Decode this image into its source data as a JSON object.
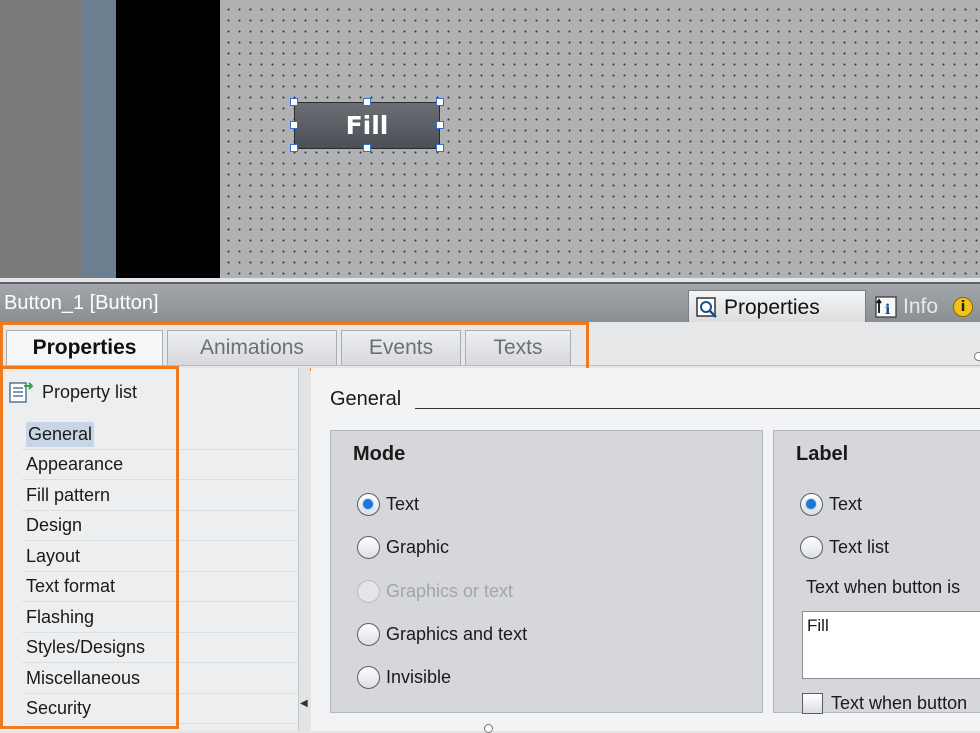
{
  "canvas": {
    "button_label": "Fill"
  },
  "inspector": {
    "selection_title": "Button_1 [Button]",
    "tabs": [
      {
        "label": "Properties",
        "icon": "properties-magnifier-icon",
        "active": true
      },
      {
        "label": "Info",
        "icon": "info-arrow-icon",
        "active": false
      }
    ],
    "diagnostics_icon": "i"
  },
  "subtabs": [
    {
      "label": "Properties",
      "active": true
    },
    {
      "label": "Animations",
      "active": false
    },
    {
      "label": "Events",
      "active": false
    },
    {
      "label": "Texts",
      "active": false
    }
  ],
  "property_nav": {
    "header": "Property list",
    "items": [
      {
        "label": "General",
        "selected": true
      },
      {
        "label": "Appearance"
      },
      {
        "label": "Fill pattern"
      },
      {
        "label": "Design"
      },
      {
        "label": "Layout"
      },
      {
        "label": "Text format"
      },
      {
        "label": "Flashing"
      },
      {
        "label": "Styles/Designs"
      },
      {
        "label": "Miscellaneous"
      },
      {
        "label": "Security"
      }
    ]
  },
  "main": {
    "section_title": "General",
    "mode": {
      "title": "Mode",
      "options": [
        {
          "label": "Text",
          "checked": true,
          "enabled": true
        },
        {
          "label": "Graphic",
          "checked": false,
          "enabled": true
        },
        {
          "label": "Graphics or text",
          "checked": false,
          "enabled": false
        },
        {
          "label": "Graphics and text",
          "checked": false,
          "enabled": true
        },
        {
          "label": "Invisible",
          "checked": false,
          "enabled": true
        }
      ]
    },
    "label": {
      "title": "Label",
      "options": [
        {
          "label": "Text",
          "checked": true
        },
        {
          "label": "Text list",
          "checked": false
        }
      ],
      "text_caption": "Text when button is",
      "text_value": "Fill",
      "pressed_checkbox_label": "Text when button"
    }
  },
  "colors": {
    "highlight": "#f07a1c",
    "radio_selected": "#1c78d3"
  }
}
